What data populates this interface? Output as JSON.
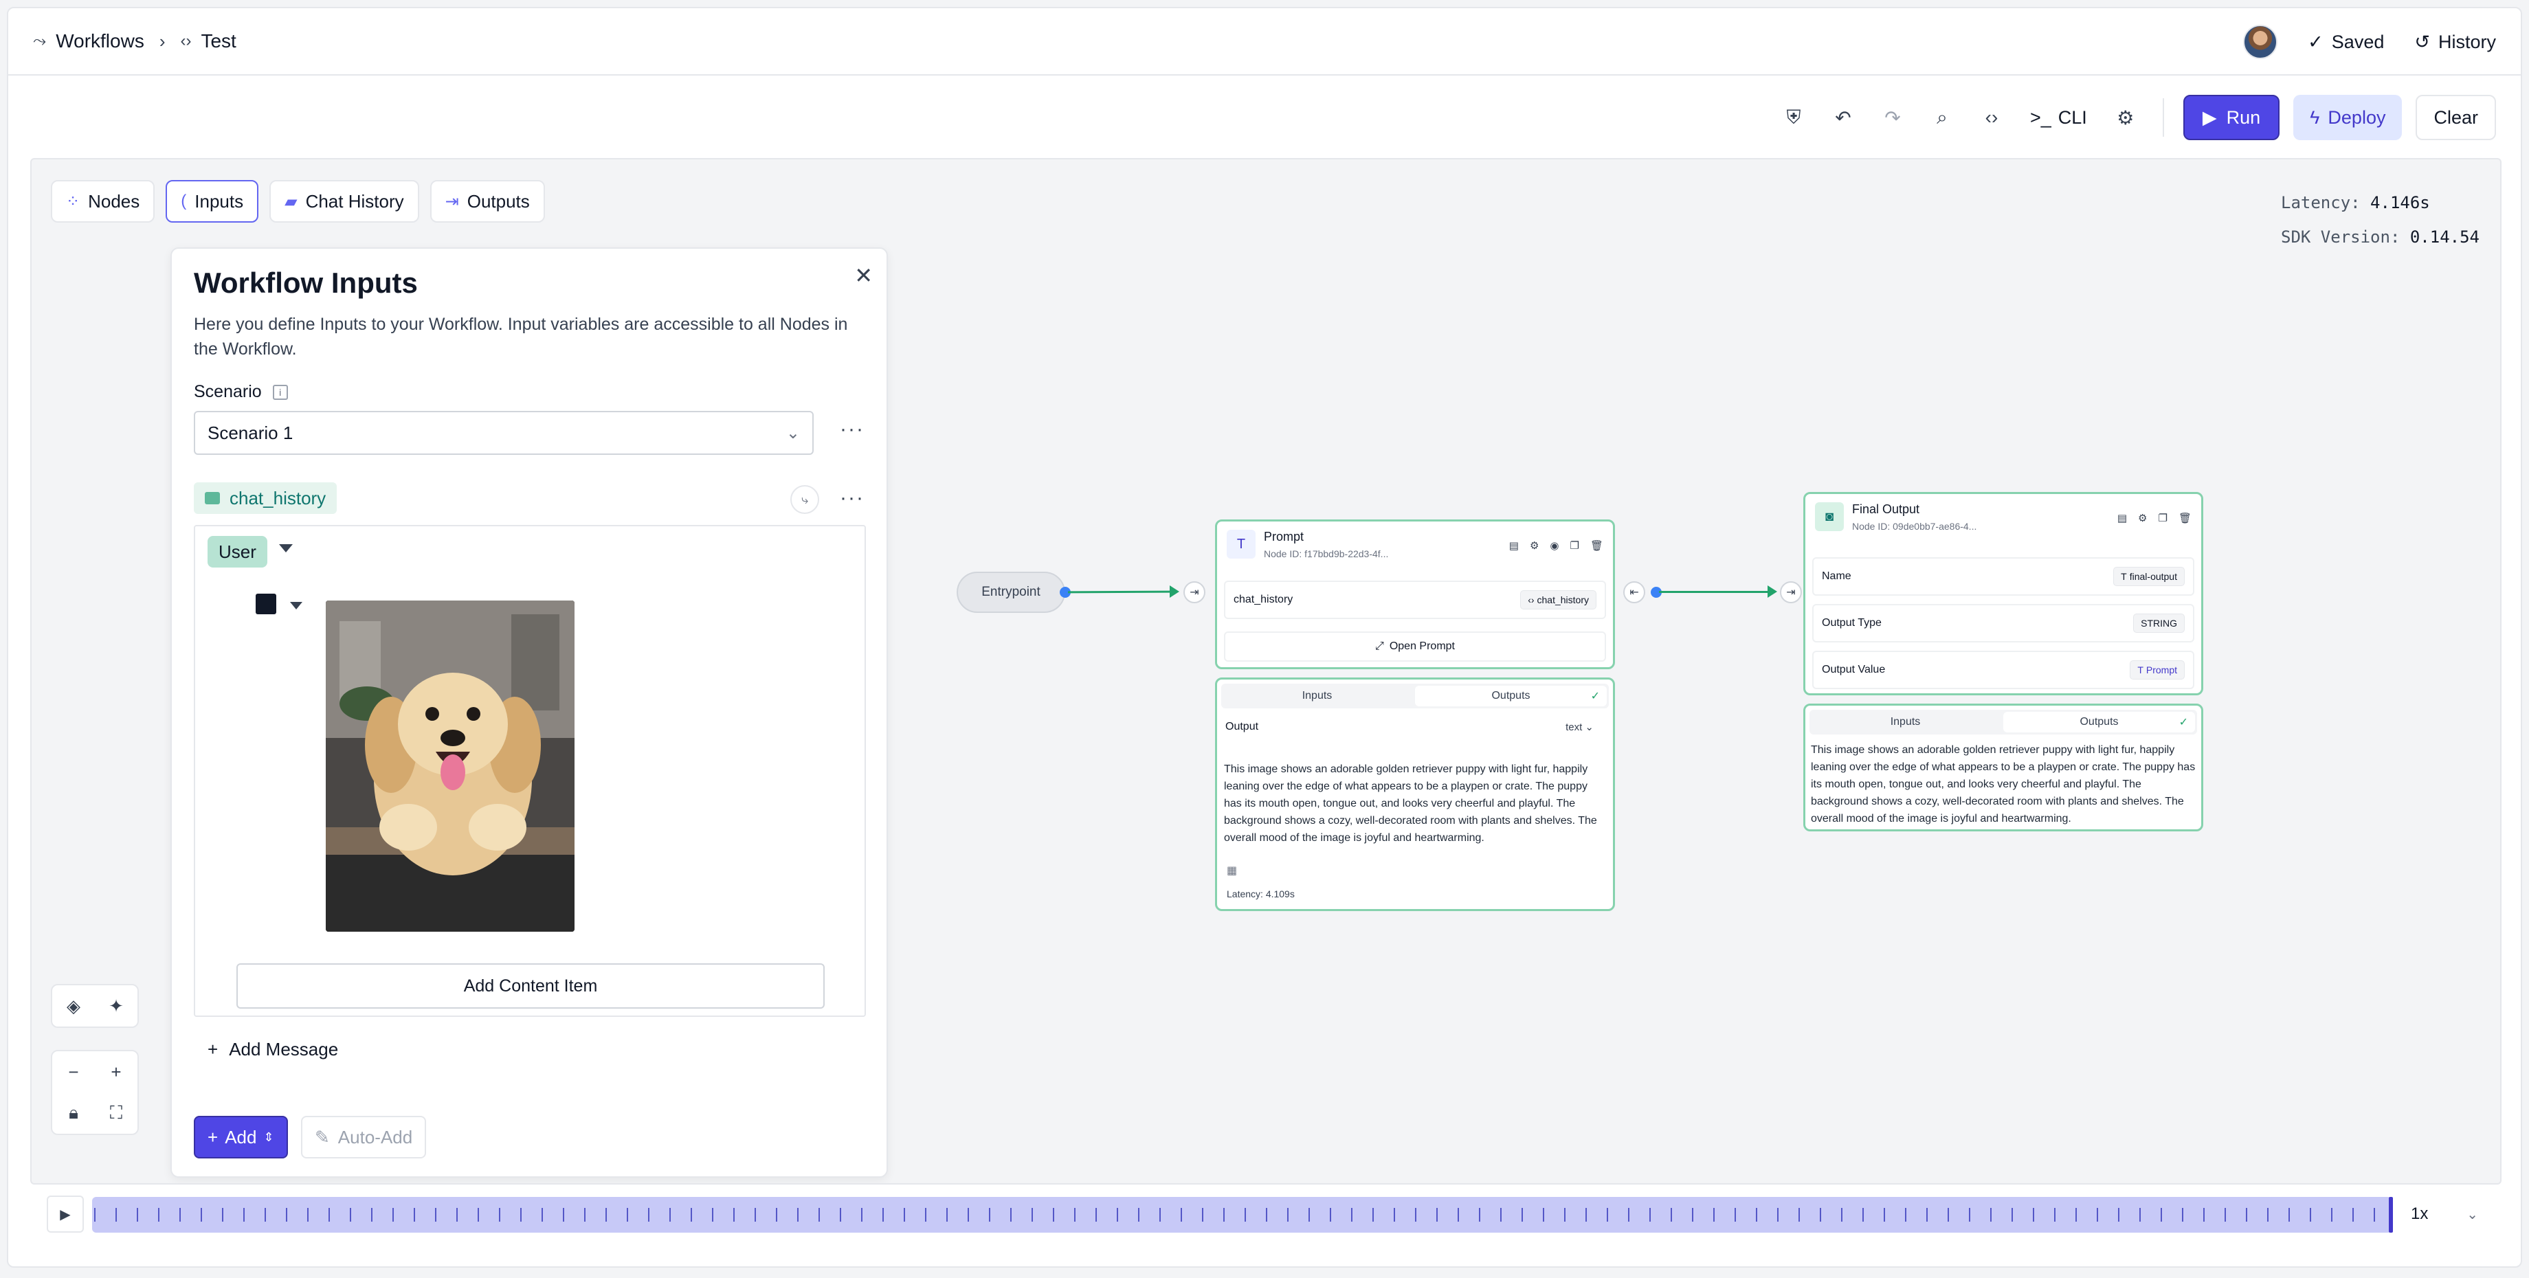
{
  "breadcrumb": {
    "root": "Workflows",
    "current": "Test"
  },
  "header": {
    "saved_label": "Saved",
    "history_label": "History"
  },
  "toolbar": {
    "cli_label": "CLI",
    "run_label": "Run",
    "deploy_label": "Deploy",
    "clear_label": "Clear"
  },
  "tabs": [
    {
      "label": "Nodes"
    },
    {
      "label": "Inputs",
      "active": true
    },
    {
      "label": "Chat History"
    },
    {
      "label": "Outputs"
    }
  ],
  "meta": {
    "latency_label": "Latency:",
    "latency_value": "4.146s",
    "sdk_label": "SDK Version:",
    "sdk_value": "0.14.54"
  },
  "panel": {
    "title": "Workflow Inputs",
    "description": "Here you define Inputs to your Workflow. Input variables are accessible to all Nodes in the Workflow.",
    "scenario_label": "Scenario",
    "scenario_value": "Scenario 1",
    "variable_name": "chat_history",
    "role": "User",
    "add_content_label": "Add Content Item",
    "add_message_label": "Add Message",
    "add_label": "Add",
    "auto_add_label": "Auto-Add"
  },
  "flow": {
    "entry_label": "Entrypoint",
    "prompt_node": {
      "title": "Prompt",
      "node_id": "Node ID:  f17bbd9b-22d3-4f...",
      "input_name": "chat_history",
      "input_value": "chat_history",
      "open_label": "Open Prompt",
      "tab_inputs": "Inputs",
      "tab_outputs": "Outputs",
      "output_label": "Output",
      "output_type": "text",
      "output_text": "This image shows an adorable golden retriever puppy with light fur, happily leaning over the edge of what appears to be a playpen or crate. The puppy has its mouth open, tongue out, and looks very cheerful and playful. The background shows a cozy, well-decorated room with plants and shelves. The overall mood of the image is joyful and heartwarming.",
      "latency": "Latency:   4.109s"
    },
    "final_node": {
      "title": "Final Output",
      "node_id": "Node ID:  09de0bb7-ae86-4...",
      "name_label": "Name",
      "name_value": "final-output",
      "type_label": "Output Type",
      "type_value": "STRING",
      "value_label": "Output Value",
      "value_value": "Prompt",
      "tab_inputs": "Inputs",
      "tab_outputs": "Outputs",
      "output_text": "This image shows an adorable golden retriever puppy with light fur, happily leaning over the edge of what appears to be a playpen or crate. The puppy has its mouth open, tongue out, and looks very cheerful and playful. The background shows a cozy, well-decorated room with plants and shelves. The overall mood of the image is joyful and heartwarming."
    }
  },
  "timeline": {
    "speed": "1x"
  },
  "colors": {
    "accent": "#4f46e5",
    "node_border": "#86d2ae",
    "edge": "#22a36b",
    "port": "#3b82f6"
  }
}
